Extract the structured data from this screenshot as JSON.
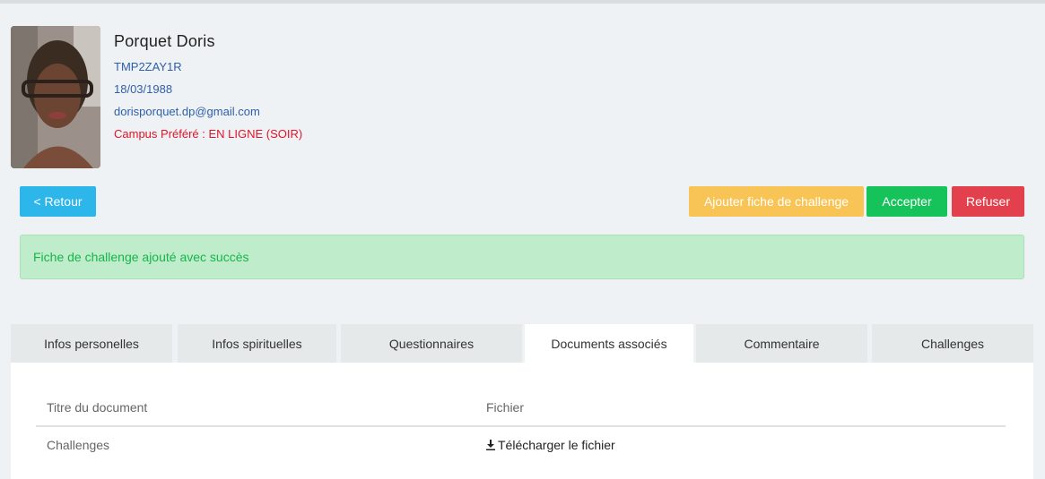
{
  "profile": {
    "name": "Porquet Doris",
    "code": "TMP2ZAY1R",
    "birthdate": "18/03/1988",
    "email": "dorisporquet.dp@gmail.com",
    "campus": "Campus Préféré : EN LIGNE (SOIR)"
  },
  "actions": {
    "back_label": "< Retour",
    "add_challenge_label": "Ajouter fiche de challenge",
    "accept_label": "Accepter",
    "refuse_label": "Refuser"
  },
  "alert": {
    "message": "Fiche de challenge ajouté avec succès"
  },
  "tabs": [
    {
      "label": "Infos personelles",
      "active": false
    },
    {
      "label": "Infos spirituelles",
      "active": false
    },
    {
      "label": "Questionnaires",
      "active": false
    },
    {
      "label": "Documents associés",
      "active": true
    },
    {
      "label": "Commentaire",
      "active": false
    },
    {
      "label": "Challenges",
      "active": false
    }
  ],
  "documents": {
    "headers": [
      "Titre du document",
      "Fichier"
    ],
    "rows": [
      {
        "title": "Challenges",
        "file_label": "Télécharger le fichier",
        "icon": "download-icon"
      }
    ]
  },
  "colors": {
    "primary": "#2db6ea",
    "warning": "#f8c455",
    "success": "#16c35a",
    "danger": "#e2404c",
    "link": "#2f5fa8",
    "campus": "#e0142a"
  }
}
